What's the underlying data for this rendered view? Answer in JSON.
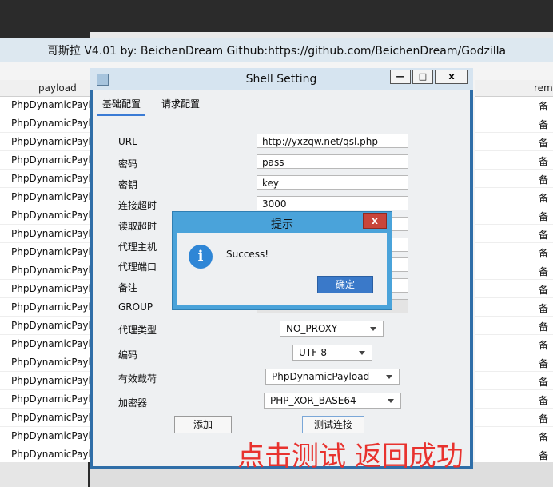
{
  "window_title": "哥斯拉  V4.01 by: BeichenDream Github:https://github.com/BeichenDream/Godzilla",
  "table": {
    "col_payload": "payload",
    "col_remark": "rem",
    "payload_rows": [
      "PhpDynamicPayload",
      "PhpDynamicPaylo",
      "PhpDynamicPaylo",
      "PhpDynamicPaylo",
      "PhpDynamicPaylo",
      "PhpDynamicPaylo",
      "PhpDynamicPaylo",
      "PhpDynamicPaylo",
      "PhpDynamicPaylo",
      "PhpDynamicPaylo",
      "PhpDynamicPaylo",
      "PhpDynamicPaylo",
      "PhpDynamicPaylo",
      "PhpDynamicPaylo",
      "PhpDynamicPaylo",
      "PhpDynamicPaylo",
      "PhpDynamicPaylo",
      "PhpDynamicPaylo",
      "PhpDynamicPaylo",
      "PhpDynamicPayload"
    ],
    "remark_rows": [
      "备",
      "备",
      "备",
      "备",
      "备",
      "备",
      "备",
      "备",
      "备",
      "备",
      "备",
      "备",
      "备",
      "备",
      "备",
      "备",
      "备",
      "备",
      "备",
      "备"
    ]
  },
  "shell_dialog": {
    "title": "Shell Setting",
    "btn_min": "—",
    "btn_max": "□",
    "btn_close": "x",
    "tab_basic": "基础配置",
    "tab_request": "请求配置",
    "labels": {
      "url": "URL",
      "password": "密码",
      "key": "密钥",
      "conn_timeout": "连接超时",
      "read_timeout": "读取超时",
      "proxy_host": "代理主机",
      "proxy_port": "代理端口",
      "remark": "备注",
      "group": "GROUP",
      "proxy_type": "代理类型",
      "encoding": "编码",
      "payload": "有效载荷",
      "cryption": "加密器"
    },
    "values": {
      "url": "http://yxzqw.net/qsl.php",
      "password": "pass",
      "key": "key",
      "conn_timeout": "3000",
      "proxy_type": "NO_PROXY",
      "encoding": "UTF-8",
      "payload": "PhpDynamicPayload",
      "cryption": "PHP_XOR_BASE64"
    },
    "btn_add": "添加",
    "btn_test": "测试连接"
  },
  "popup": {
    "title": "提示",
    "close": "x",
    "message": "Success!",
    "ok": "确定"
  },
  "annotation": "点击测试 返回成功"
}
